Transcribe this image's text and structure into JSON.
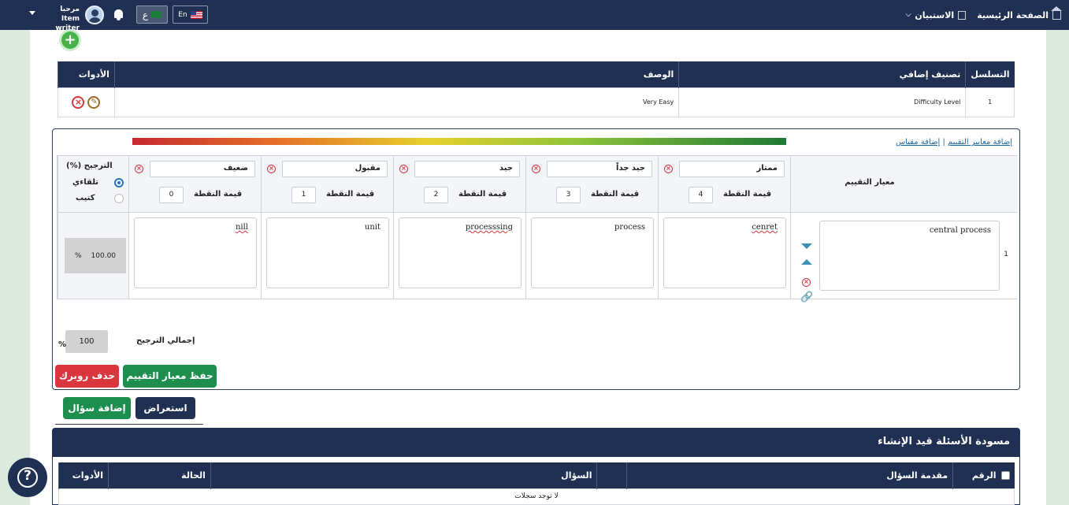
{
  "topbar": {
    "home": "الصفحة الرئيسية",
    "surveys": "الاستبيان",
    "greeting": "مرحبا",
    "user": "Item writer",
    "lang_ar": "ع",
    "lang_en": "En"
  },
  "classification": {
    "headers": [
      "التسلسل",
      "تصنيف إضافي",
      "الوصف",
      "الأدوات"
    ],
    "rows": [
      {
        "seq": "1",
        "extra": "Difficulty Level",
        "desc": "Very Easy"
      }
    ]
  },
  "rubric": {
    "link_criteria": "إضافة معايير التقييم",
    "link_sep": "|",
    "link_scale": "إضافة مقياس",
    "criteria_header": "معيار التقييم",
    "point_label": "قيمة النقطة",
    "levels": [
      {
        "name": "ممتاز",
        "points": "4",
        "answer": "cenret"
      },
      {
        "name": "جيد جداً",
        "points": "3",
        "answer": "process"
      },
      {
        "name": "جيد",
        "points": "2",
        "answer": "processsing"
      },
      {
        "name": "مقبول",
        "points": "1",
        "answer": "unit"
      },
      {
        "name": "ضعيف",
        "points": "0",
        "answer": "nill"
      }
    ],
    "weight_header": "(%) الترجيح",
    "weight_auto": "تلقاءي",
    "weight_manual": "كتيب",
    "row_number": "1",
    "criterion_text": "central process",
    "row_weight": "100.00",
    "row_weight_unit": "%",
    "total_label": "إجمالي الترجيح",
    "total_value": "100",
    "total_unit": "%",
    "save_button": "حفظ معيار التقييم",
    "delete_button": "حذف روبرك"
  },
  "actions": {
    "preview": "استعراض",
    "add_question": "إضافة سؤال"
  },
  "drafts": {
    "title": "مسودة الأسئلة قيد الإنشاء",
    "headers": [
      "الرقم",
      "مقدمة السؤال",
      "",
      "السؤال",
      "الحالة",
      "الأدوات"
    ],
    "empty": "لا توجد سجلات"
  },
  "help": {
    "icon": "?"
  },
  "colors": {
    "navy": "#1f3052",
    "green": "#1e8e4e",
    "red": "#d9363e"
  }
}
